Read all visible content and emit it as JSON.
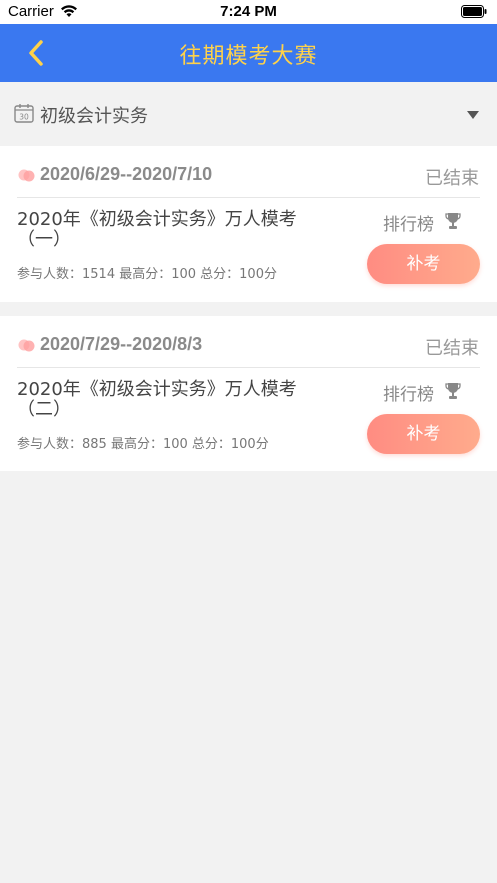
{
  "status_bar": {
    "carrier": "Carrier",
    "time": "7:24 PM"
  },
  "nav": {
    "title": "往期模考大赛",
    "back_icon": "chevron-left-icon",
    "title_color": "#ffd24a",
    "bar_color": "#3a78f0"
  },
  "subject": {
    "label": "初级会计实务",
    "calendar_day": "30"
  },
  "exams": [
    {
      "date_range": "2020/6/29--2020/7/10",
      "status": "已结束",
      "title": "2020年《初级会计实务》万人模考（一）",
      "stats": "参与人数：1514  最高分：100  总分：100分",
      "ranking_label": "排行榜",
      "retake_label": "补考"
    },
    {
      "date_range": "2020/7/29--2020/8/3",
      "status": "已结束",
      "title": "2020年《初级会计实务》万人模考（二）",
      "stats": "参与人数：885  最高分：100  总分：100分",
      "ranking_label": "排行榜",
      "retake_label": "补考"
    }
  ]
}
